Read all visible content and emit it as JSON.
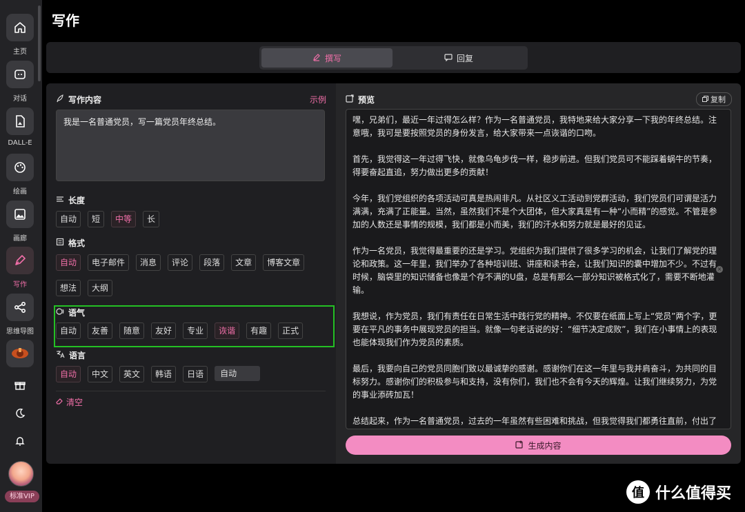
{
  "page_title": "写作",
  "sidebar": {
    "items": [
      {
        "label": "主页",
        "icon": "home-icon"
      },
      {
        "label": "对话",
        "icon": "chat-icon"
      },
      {
        "label": "DALL-E",
        "icon": "image-generate-icon"
      },
      {
        "label": "绘画",
        "icon": "palette-icon"
      },
      {
        "label": "画廊",
        "icon": "gallery-icon"
      },
      {
        "label": "写作",
        "icon": "pen-icon"
      },
      {
        "label": "思维导图",
        "icon": "mindmap-icon"
      },
      {
        "label": "",
        "icon": "plugin-icon"
      }
    ],
    "active": "写作",
    "vip_label": "标准VIP"
  },
  "tabs": [
    {
      "label": "撰写",
      "icon": "edit-icon",
      "active": true
    },
    {
      "label": "回复",
      "icon": "reply-icon",
      "active": false
    }
  ],
  "left": {
    "content_title": "写作内容",
    "example_link": "示例",
    "prompt_text": "我是一名普通党员，写一篇党员年终总结。",
    "length": {
      "title": "长度",
      "options": [
        "自动",
        "短",
        "中等",
        "长"
      ],
      "selected": "中等"
    },
    "format": {
      "title": "格式",
      "options": [
        "自动",
        "电子邮件",
        "消息",
        "评论",
        "段落",
        "文章",
        "博客文章",
        "想法",
        "大纲"
      ],
      "selected": "自动"
    },
    "tone": {
      "title": "语气",
      "options": [
        "自动",
        "友善",
        "随意",
        "友好",
        "专业",
        "诙谐",
        "有趣",
        "正式"
      ],
      "selected": "诙谐"
    },
    "language": {
      "title": "语言",
      "options": [
        "自动",
        "中文",
        "英文",
        "韩语",
        "日语"
      ],
      "selected": "自动",
      "dropdown_value": "自动"
    },
    "clear_label": "清空"
  },
  "right": {
    "preview_title": "预览",
    "copy_label": "复制",
    "paragraphs": [
      "嘿，兄弟们，最近一年过得怎么样？作为一名普通党员，我特地来给大家分享一下我的年终总结。注意哦，我可是要按照党员的身份发言，给大家带来一点诙谐的口吻。",
      "首先，我觉得这一年过得飞快，就像乌龟步伐一样，稳步前进。但我们党员可不能踩着蜗牛的节奏，得要奋起直追，努力做出更多的贡献！",
      "今年，我们党组织的各项活动可真是热闹非凡。从社区义工活动到党群活动，我们党员们可谓是活力满满，充满了正能量。当然，虽然我们不是个大团体，但大家真是有一种“小而精”的感觉。不管是参加的人数还是事情的规模，我们都是小而美，我们的汗水和努力就是最好的见证。",
      "作为一名党员，我觉得最重要的还是学习。党组织为我们提供了很多学习的机会，让我们了解党的理论和政策。这一年里，我们举办了各种培训班、讲座和读书会，让我们知识的囊中增加不少。不过有时候，脑袋里的知识储备也像是个存不满的U盘，总是有那么一部分知识被格式化了，需要不断地灌输。",
      "我想说，作为党员，我们有责任在日常生活中践行党的精神。不仅要在纸面上写上“党员”两个字，更要在平凡的事务中展现党员的担当。就像一句老话说的好：“细节决定成败”，我们在小事情上的表现也能体现我们作为党员的素质。",
      "最后，我要向自己的党员同胞们致以最诚挚的感谢。感谢你们在这一年里与我并肩奋斗，为共同的目标努力。感谢你们的积极参与和支持，没有你们，我们也不会有今天的辉煌。让我们继续努力，为党的事业添砖加瓦！",
      "总结起来，作为一名普通党员，过去的一年虽然有些困难和挑战，但我觉得我们都勇往直前，付出了"
    ],
    "generate_label": "生成内容"
  },
  "watermark": {
    "logo": "值",
    "text": "什么值得买"
  },
  "colors": {
    "accent": "#f06fa8",
    "highlight_box": "#24c124",
    "generate_button": "#f38cc2"
  }
}
